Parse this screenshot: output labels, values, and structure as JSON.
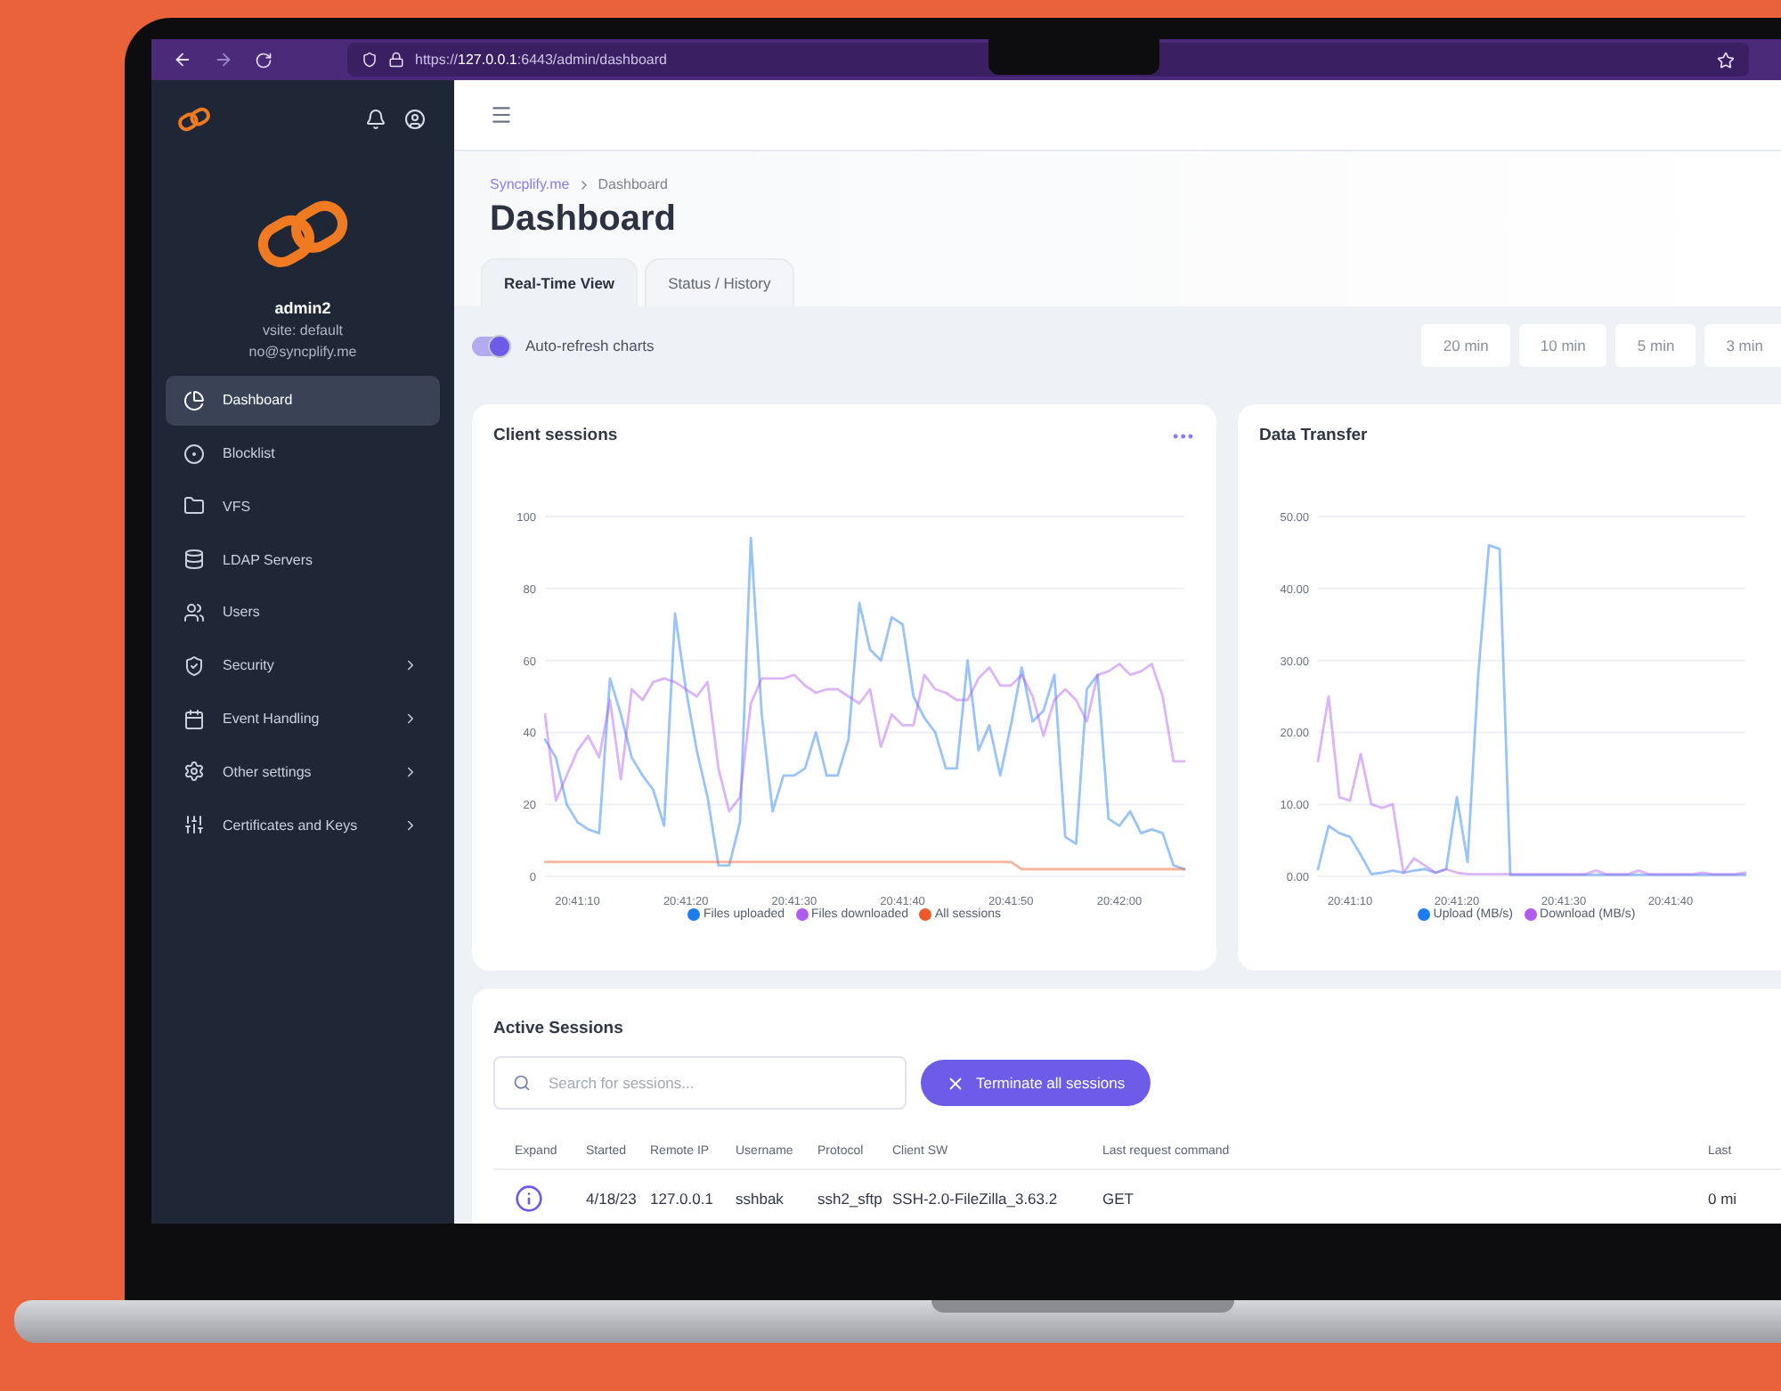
{
  "browser": {
    "url": "https://**127.0.0.1**:6443/admin/dashboard"
  },
  "sidebar": {
    "user": {
      "name": "admin2",
      "vsite": "vsite: default",
      "email": "no@syncplify.me"
    },
    "items": [
      {
        "label": "Dashboard",
        "selected": true,
        "has_submenu": false
      },
      {
        "label": "Blocklist",
        "selected": false,
        "has_submenu": false
      },
      {
        "label": "VFS",
        "selected": false,
        "has_submenu": false
      },
      {
        "label": "LDAP Servers",
        "selected": false,
        "has_submenu": false
      },
      {
        "label": "Users",
        "selected": false,
        "has_submenu": false
      },
      {
        "label": "Security",
        "selected": false,
        "has_submenu": true
      },
      {
        "label": "Event Handling",
        "selected": false,
        "has_submenu": true
      },
      {
        "label": "Other settings",
        "selected": false,
        "has_submenu": true
      },
      {
        "label": "Certificates and Keys",
        "selected": false,
        "has_submenu": true
      }
    ]
  },
  "header": {
    "breadcrumb": [
      "Syncplify.me",
      "Dashboard"
    ],
    "title": "Dashboard",
    "tabs": [
      {
        "label": "Real-Time View",
        "selected": true
      },
      {
        "label": "Status / History",
        "selected": false
      }
    ]
  },
  "toolbar": {
    "auto_refresh": {
      "label": "Auto-refresh charts",
      "on": true
    },
    "ranges": [
      {
        "label": "20 min",
        "selected": false
      },
      {
        "label": "10 min",
        "selected": false
      },
      {
        "label": "5 min",
        "selected": false
      },
      {
        "label": "3 min",
        "selected": false
      }
    ]
  },
  "charts": [
    {
      "title": "Client sessions",
      "chart_data": {
        "type": "line",
        "categories": [
          null,
          null,
          null,
          "20:41:10",
          null,
          null,
          null,
          null,
          null,
          null,
          null,
          null,
          null,
          "20:41:20",
          null,
          null,
          null,
          null,
          null,
          null,
          null,
          null,
          null,
          "20:41:30",
          null,
          null,
          null,
          null,
          null,
          null,
          null,
          null,
          null,
          "20:41:40",
          null,
          null,
          null,
          null,
          null,
          null,
          null,
          null,
          null,
          "20:41:50",
          null,
          null,
          null,
          null,
          null,
          null,
          null,
          null,
          null,
          "20:42:00",
          null,
          null,
          null,
          null,
          null,
          null
        ],
        "ylim": [
          0,
          100
        ],
        "grid": true,
        "yticks": [
          0,
          20,
          40,
          60,
          80,
          100
        ],
        "series": [
          {
            "name": "Files uploaded",
            "color": "#1e7bf0",
            "values": [
              38,
              33,
              20,
              15,
              13,
              12,
              55,
              45,
              33,
              28,
              24,
              14,
              73,
              52,
              35,
              22,
              3,
              3,
              15,
              94,
              45,
              18,
              28,
              28,
              30,
              40,
              28,
              28,
              38,
              76,
              63,
              60,
              72,
              70,
              50,
              44,
              40,
              30,
              30,
              60,
              35,
              42,
              28,
              42,
              58,
              43,
              46,
              56,
              11,
              9,
              52,
              56,
              16,
              14,
              18,
              12,
              13,
              12,
              3,
              2
            ]
          },
          {
            "name": "Files downloaded",
            "color": "#b05cf0",
            "values": [
              45,
              21,
              28,
              35,
              39,
              33,
              49,
              27,
              52,
              49,
              54,
              55,
              54,
              52,
              50,
              54,
              30,
              18,
              22,
              48,
              55,
              55,
              55,
              56,
              53,
              51,
              52,
              52,
              50,
              48,
              52,
              36,
              45,
              42,
              42,
              56,
              52,
              51,
              49,
              49,
              55,
              58,
              53,
              53,
              56,
              50,
              39,
              49,
              52,
              49,
              43,
              56,
              57,
              59,
              56,
              57,
              59,
              50,
              32,
              32
            ]
          },
          {
            "name": "All sessions",
            "color": "#f05a28",
            "values": [
              4,
              4,
              4,
              4,
              4,
              4,
              4,
              4,
              4,
              4,
              4,
              4,
              4,
              4,
              4,
              4,
              4,
              4,
              4,
              4,
              4,
              4,
              4,
              4,
              4,
              4,
              4,
              4,
              4,
              4,
              4,
              4,
              4,
              4,
              4,
              4,
              4,
              4,
              4,
              4,
              4,
              4,
              4,
              4,
              2,
              2,
              2,
              2,
              2,
              2,
              2,
              2,
              2,
              2,
              2,
              2,
              2,
              2,
              2,
              2
            ]
          }
        ]
      },
      "menu": "•••"
    },
    {
      "title": "Data Transfer",
      "chart_data": {
        "type": "line",
        "categories": [
          null,
          null,
          null,
          "20:41:10",
          null,
          null,
          null,
          null,
          null,
          null,
          null,
          null,
          null,
          "20:41:20",
          null,
          null,
          null,
          null,
          null,
          null,
          null,
          null,
          null,
          "20:41:30",
          null,
          null,
          null,
          null,
          null,
          null,
          null,
          null,
          null,
          "20:41:40",
          null,
          null,
          null,
          null,
          null,
          null,
          null
        ],
        "ylim": [
          0,
          50
        ],
        "grid": true,
        "yticks": [
          {
            "value": 0,
            "label": "0.00"
          },
          {
            "value": 10,
            "label": "10.00"
          },
          {
            "value": 20,
            "label": "20.00"
          },
          {
            "value": 30,
            "label": "30.00"
          },
          {
            "value": 40,
            "label": "40.00"
          },
          {
            "value": 50,
            "label": "50.00"
          }
        ],
        "series": [
          {
            "name": "Upload (MB/s)",
            "color": "#1e7bf0",
            "values": [
              1,
              7,
              6,
              5.5,
              3,
              0.3,
              0.5,
              0.8,
              0.5,
              0.8,
              1,
              0.5,
              1,
              11,
              2,
              28,
              46,
              45.5,
              0.2,
              0.2,
              0.2,
              0.2,
              0.2,
              0.2,
              0.2,
              0.2,
              0.2,
              0.2,
              0.2,
              0.2,
              0.2,
              0.2,
              0.2,
              0.2,
              0.2,
              0.2,
              0.2,
              0.2,
              0.2,
              0.2,
              0.2
            ]
          },
          {
            "name": "Download (MB/s)",
            "color": "#b05cf0",
            "values": [
              16,
              25,
              11,
              10.5,
              17,
              10,
              9.5,
              10,
              0.5,
              2.5,
              1.5,
              0.5,
              1,
              0.5,
              0.3,
              0.3,
              0.3,
              0.3,
              0.3,
              0.3,
              0.3,
              0.3,
              0.3,
              0.3,
              0.3,
              0.3,
              0.8,
              0.3,
              0.3,
              0.3,
              0.8,
              0.3,
              0.3,
              0.3,
              0.3,
              0.3,
              0.5,
              0.3,
              0.3,
              0.3,
              0.5
            ]
          }
        ]
      }
    }
  ],
  "sessions": {
    "title": "Active Sessions",
    "search": {
      "placeholder": "Search for sessions..."
    },
    "terminate_button": "Terminate all sessions",
    "columns": [
      "Expand",
      "Started",
      "Remote IP",
      "Username",
      "Protocol",
      "Client SW",
      "Last request command",
      "Last"
    ],
    "rows": [
      [
        "",
        "4/18/23",
        "127.0.0.1",
        "sshbak",
        "ssh2_sftp",
        "SSH-2.0-FileZilla_3.63.2",
        "GET",
        "0 mi"
      ]
    ]
  }
}
